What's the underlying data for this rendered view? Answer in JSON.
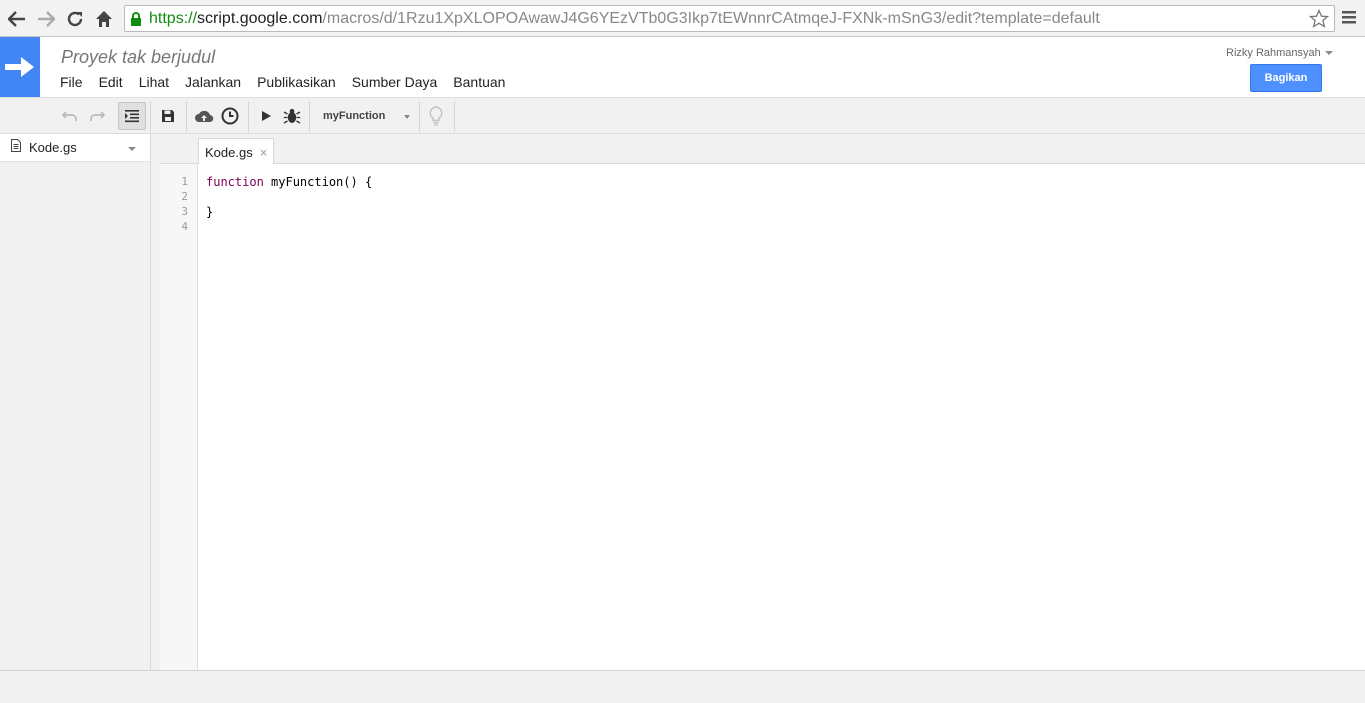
{
  "browser": {
    "url_scheme": "https://",
    "url_host": "script.google.com",
    "url_path": "/macros/d/1Rzu1XpXLOPOAwawJ4G6YEzVTb0G3Ikp7tEWnnrCAtmqeJ-FXNk-mSnG3/edit?template=default"
  },
  "header": {
    "project_title": "Proyek tak berjudul",
    "user_name": "Rizky Rahmansyah",
    "share_label": "Bagikan",
    "menu": [
      "File",
      "Edit",
      "Lihat",
      "Jalankan",
      "Publikasikan",
      "Sumber Daya",
      "Bantuan"
    ]
  },
  "toolbar": {
    "selected_function": "myFunction"
  },
  "sidebar": {
    "files": [
      {
        "name": "Kode.gs"
      }
    ]
  },
  "editor": {
    "tab_label": "Kode.gs",
    "tab_close": "×",
    "line_numbers": [
      "1",
      "2",
      "3",
      "4"
    ],
    "lines": {
      "l1_keyword": "function",
      "l1_rest": " myFunction() {",
      "l2": "",
      "l3": "}",
      "l4": ""
    }
  },
  "colors": {
    "accent": "#4285f4",
    "share_button": "#4d90fe",
    "keyword": "#7f0055",
    "secure_scheme": "#118c11"
  }
}
